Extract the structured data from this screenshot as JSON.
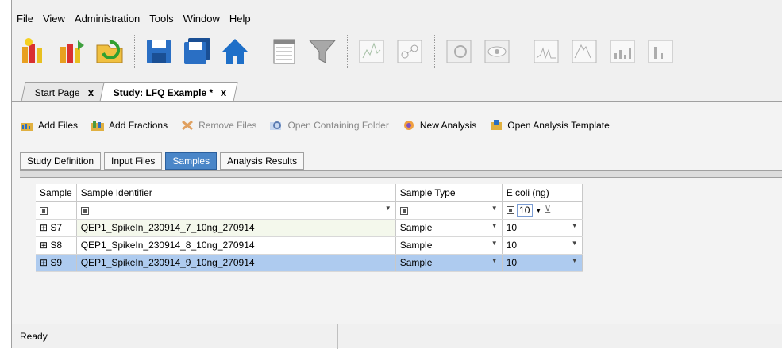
{
  "menu": [
    "File",
    "View",
    "Administration",
    "Tools",
    "Window",
    "Help"
  ],
  "toolbar": {
    "icons": [
      "new-study-icon",
      "open-study-icon",
      "refresh-icon",
      "save-icon",
      "save-all-icon",
      "home-icon",
      "grid-view-icon",
      "filter-icon",
      "spectrum-view-icon",
      "molecule-icon",
      "chromatogram-icon",
      "eye-view-icon",
      "peak-chart-icon",
      "peak-chart-2-icon",
      "bar-chart-icon",
      "bar-chart-2-icon"
    ]
  },
  "tabs": {
    "start": "Start Page",
    "study": "Study: LFQ Example *",
    "close": "x"
  },
  "actions": {
    "add_files": "Add Files",
    "add_fractions": "Add Fractions",
    "remove_files": "Remove Files",
    "open_folder": "Open Containing Folder",
    "new_analysis": "New Analysis",
    "open_template": "Open Analysis Template"
  },
  "subtabs": [
    "Study Definition",
    "Input Files",
    "Samples",
    "Analysis Results"
  ],
  "grid": {
    "headers": [
      "Sample",
      "Sample Identifier",
      "Sample Type",
      "E coli (ng)"
    ],
    "filter_value": "10",
    "rows": [
      {
        "expander": "⊞",
        "sample": "S7",
        "identifier": "QEP1_SpikeIn_230914_7_10ng_270914",
        "type": "Sample",
        "ecoli": "10"
      },
      {
        "expander": "⊞",
        "sample": "S8",
        "identifier": "QEP1_SpikeIn_230914_8_10ng_270914",
        "type": "Sample",
        "ecoli": "10"
      },
      {
        "expander": "⊞",
        "sample": "S9",
        "identifier": "QEP1_SpikeIn_230914_9_10ng_270914",
        "type": "Sample",
        "ecoli": "10"
      }
    ]
  },
  "status": {
    "text": "Ready"
  },
  "colors": {
    "selected_tab": "#4a86c8",
    "selected_row": "#aecbef",
    "row_tint": "#f4f8ec"
  }
}
